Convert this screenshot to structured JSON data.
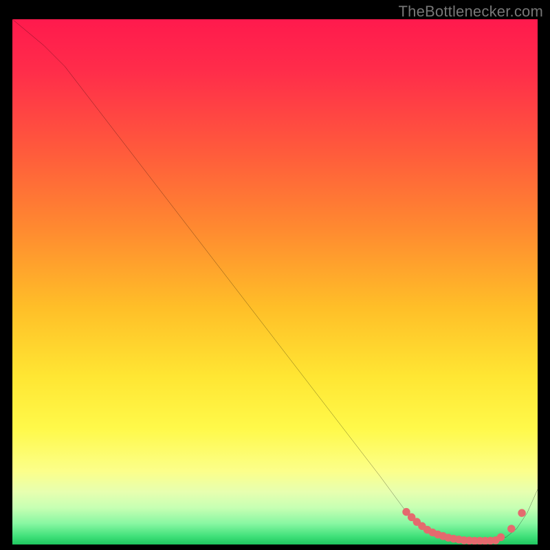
{
  "watermark": "TheBottlenecker.com",
  "colors": {
    "gradient_stops": [
      {
        "offset": 0.0,
        "color": "#ff1a4d"
      },
      {
        "offset": 0.1,
        "color": "#ff2d4a"
      },
      {
        "offset": 0.25,
        "color": "#ff5a3c"
      },
      {
        "offset": 0.4,
        "color": "#ff8a30"
      },
      {
        "offset": 0.55,
        "color": "#ffbf28"
      },
      {
        "offset": 0.68,
        "color": "#ffe633"
      },
      {
        "offset": 0.78,
        "color": "#fff94a"
      },
      {
        "offset": 0.86,
        "color": "#fcff8a"
      },
      {
        "offset": 0.9,
        "color": "#e7ffb0"
      },
      {
        "offset": 0.93,
        "color": "#c7ffb3"
      },
      {
        "offset": 0.96,
        "color": "#88f7a2"
      },
      {
        "offset": 0.985,
        "color": "#3fe079"
      },
      {
        "offset": 1.0,
        "color": "#1fc65f"
      }
    ],
    "line": "#000000",
    "marker": "#e46a6e"
  },
  "chart_data": {
    "type": "line",
    "title": "",
    "xlabel": "",
    "ylabel": "",
    "xlim": [
      0,
      100
    ],
    "ylim": [
      0,
      100
    ],
    "x": [
      0,
      6,
      10,
      20,
      30,
      40,
      50,
      60,
      70,
      75,
      78,
      80,
      82,
      84,
      86,
      88,
      90,
      92,
      94,
      96,
      98,
      100
    ],
    "y": [
      100,
      95,
      91,
      78,
      65,
      52,
      39,
      26,
      13,
      6.2,
      3.5,
      2.3,
      1.6,
      1.1,
      0.8,
      0.7,
      0.7,
      0.8,
      1.4,
      3.0,
      6.0,
      10.5
    ],
    "markers_x": [
      75,
      76,
      77,
      78,
      79,
      80,
      81,
      82,
      83,
      84,
      85,
      86,
      87,
      88,
      89,
      90,
      91,
      92,
      93,
      95,
      97
    ],
    "markers_y": [
      6.2,
      5.2,
      4.3,
      3.5,
      2.8,
      2.3,
      1.9,
      1.6,
      1.3,
      1.1,
      0.95,
      0.8,
      0.75,
      0.7,
      0.7,
      0.7,
      0.72,
      0.8,
      1.4,
      3.0,
      6.0
    ]
  }
}
